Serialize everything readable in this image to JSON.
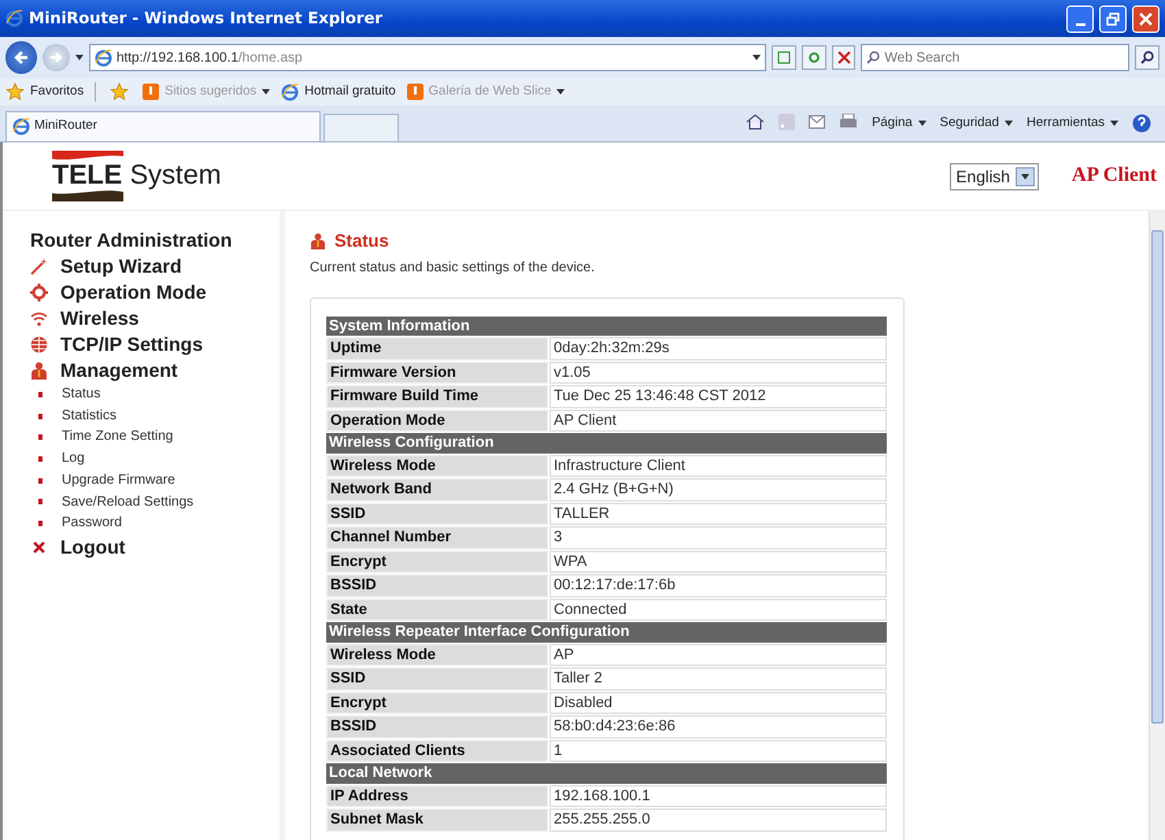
{
  "window": {
    "title": "MiniRouter - Windows Internet Explorer"
  },
  "address_bar": {
    "url_host": "http://192.168.100.1",
    "url_path": "/home.asp",
    "search_placeholder": "Web Search"
  },
  "favorites_bar": {
    "favorites": "Favoritos",
    "links": [
      {
        "label": "Sitios sugeridos",
        "kind": "menu",
        "disabled": true
      },
      {
        "label": "Hotmail gratuito",
        "kind": "link",
        "disabled": false
      },
      {
        "label": "Galería de Web Slice",
        "kind": "menu",
        "disabled": true
      }
    ]
  },
  "tab": {
    "title": "MiniRouter"
  },
  "command_bar": [
    "Página",
    "Seguridad",
    "Herramientas"
  ],
  "header": {
    "logo_left": "TELE",
    "logo_right": "System",
    "language": "English",
    "mode": "AP Client"
  },
  "sidebar": {
    "heading": "Router Administration",
    "items": [
      {
        "label": "Setup Wizard",
        "kind": "main"
      },
      {
        "label": "Operation Mode",
        "kind": "main"
      },
      {
        "label": "Wireless",
        "kind": "main"
      },
      {
        "label": "TCP/IP Settings",
        "kind": "main"
      },
      {
        "label": "Management",
        "kind": "main"
      },
      {
        "label": "Status",
        "kind": "sub"
      },
      {
        "label": "Statistics",
        "kind": "sub"
      },
      {
        "label": "Time Zone Setting",
        "kind": "sub"
      },
      {
        "label": "Log",
        "kind": "sub"
      },
      {
        "label": "Upgrade Firmware",
        "kind": "sub"
      },
      {
        "label": "Save/Reload Settings",
        "kind": "sub"
      },
      {
        "label": "Password",
        "kind": "sub"
      },
      {
        "label": "Logout",
        "kind": "logout"
      }
    ]
  },
  "content": {
    "title": "Status",
    "description": "Current status and basic settings of the device.",
    "sections": [
      {
        "title": "System Information",
        "rows": [
          [
            "Uptime",
            "0day:2h:32m:29s"
          ],
          [
            "Firmware Version",
            "v1.05"
          ],
          [
            "Firmware Build Time",
            "Tue Dec 25 13:46:48 CST 2012"
          ],
          [
            "Operation Mode",
            "AP Client"
          ]
        ]
      },
      {
        "title": "Wireless Configuration",
        "rows": [
          [
            "Wireless Mode",
            "Infrastructure Client"
          ],
          [
            "Network Band",
            "2.4 GHz (B+G+N)"
          ],
          [
            "SSID",
            "TALLER"
          ],
          [
            "Channel Number",
            "3"
          ],
          [
            "Encrypt",
            "WPA"
          ],
          [
            "BSSID",
            "00:12:17:de:17:6b"
          ],
          [
            "State",
            "Connected"
          ]
        ]
      },
      {
        "title": "Wireless Repeater Interface Configuration",
        "rows": [
          [
            "Wireless Mode",
            "AP"
          ],
          [
            "SSID",
            "Taller 2"
          ],
          [
            "Encrypt",
            "Disabled"
          ],
          [
            "BSSID",
            "58:b0:d4:23:6e:86"
          ],
          [
            "Associated Clients",
            "1"
          ]
        ]
      },
      {
        "title": "Local Network",
        "rows": [
          [
            "IP Address",
            "192.168.100.1"
          ],
          [
            "Subnet Mask",
            "255.255.255.0"
          ]
        ]
      }
    ]
  }
}
